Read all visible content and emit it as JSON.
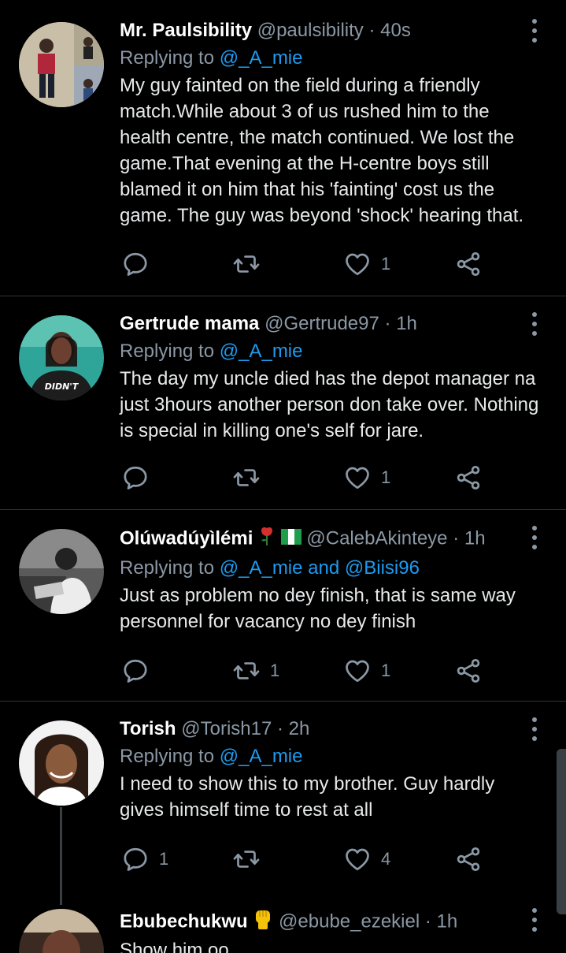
{
  "tweets": [
    {
      "name": "Mr. Paulsibility",
      "handle": "@paulsibility",
      "time": "40s",
      "replying_prefix": "Replying to ",
      "replying_to": "@_A_mie",
      "text": "My guy fainted on the field during a friendly match.While about 3 of us rushed him to the health centre, the match continued. We lost the game.That evening at the H-centre boys still blamed it on him that his 'fainting' cost us the game. The guy was beyond 'shock' hearing that.",
      "reply_count": "",
      "retweet_count": "",
      "like_count": "1"
    },
    {
      "name": "Gertrude mama",
      "handle": "@Gertrude97",
      "time": "1h",
      "replying_prefix": "Replying to ",
      "replying_to": "@_A_mie",
      "text": "The day my uncle died has the depot manager na just 3hours another person don take over. Nothing is special in killing one's self for jare.",
      "avatar_shirt_text": "DIDN'T",
      "reply_count": "",
      "retweet_count": "",
      "like_count": "1"
    },
    {
      "name": "Olúwadúyìlémi",
      "name_emoji": [
        "rose",
        "nigeria-flag"
      ],
      "handle": "@CalebAkinteye",
      "time": "1h",
      "replying_prefix": "Replying to ",
      "replying_to": "@_A_mie and @Biisi96",
      "text": "Just as problem no dey finish, that is same way personnel for vacancy no dey finish",
      "reply_count": "",
      "retweet_count": "1",
      "like_count": "1"
    },
    {
      "name": "Torish",
      "handle": "@Torish17",
      "time": "2h",
      "replying_prefix": "Replying to ",
      "replying_to": "@_A_mie",
      "text": "I need to show this to my brother. Guy hardly gives himself time to rest at all",
      "reply_count": "1",
      "retweet_count": "",
      "like_count": "4"
    },
    {
      "name": "Ebubechukwu",
      "name_emoji": [
        "raised-fist"
      ],
      "handle": "@ebube_ezekiel",
      "time": "1h",
      "text": "Show him oo"
    }
  ],
  "separator": "·",
  "colors": {
    "background": "#000000",
    "mention": "#1d9bf0",
    "secondary_text": "#8b98a5",
    "divider": "#2f3336"
  }
}
